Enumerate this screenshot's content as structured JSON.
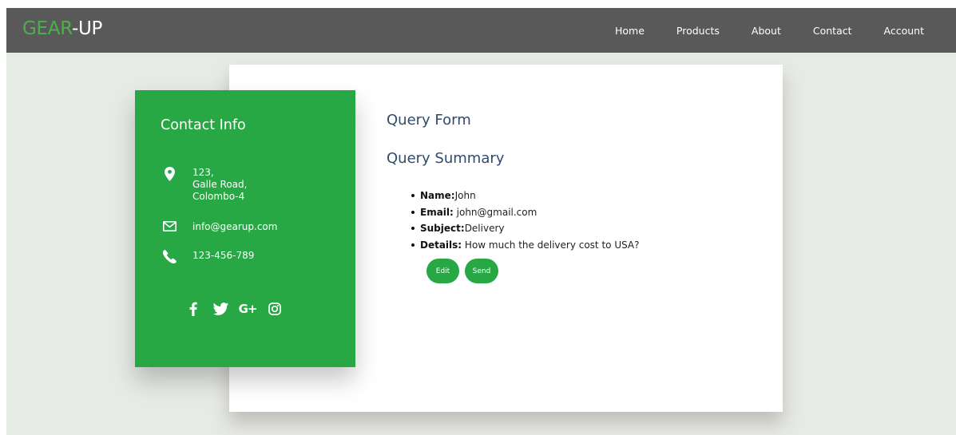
{
  "brand": {
    "part1": "GEAR",
    "part2": "-UP"
  },
  "nav": {
    "items": [
      {
        "label": "Home"
      },
      {
        "label": "Products"
      },
      {
        "label": "About"
      },
      {
        "label": "Contact"
      },
      {
        "label": "Account"
      }
    ]
  },
  "contact": {
    "title": "Contact Info",
    "address": [
      "123,",
      "Galle Road,",
      "Colombo-4"
    ],
    "email": "info@gearup.com",
    "phone": "123-456-789",
    "social_icons": [
      "facebook-icon",
      "twitter-icon",
      "google-plus-icon",
      "instagram-icon"
    ]
  },
  "query": {
    "form_title": "Query Form",
    "summary_title": "Query Summary",
    "summary": [
      {
        "key": "Name:",
        "value": "John"
      },
      {
        "key": "Email:",
        "value": " john@gmail.com"
      },
      {
        "key": "Subject:",
        "value": "Delivery"
      },
      {
        "key": "Details:",
        "value": " How much the delivery cost to USA?"
      }
    ],
    "buttons": {
      "edit": "Edit",
      "send": "Send"
    },
    "social_g_label": "G+"
  },
  "colors": {
    "accent_green": "#28a745",
    "logo_green": "#4cb04c",
    "navbar": "#595959",
    "page_bg": "#e7ebe6",
    "heading_blue": "#2f4a6b"
  }
}
